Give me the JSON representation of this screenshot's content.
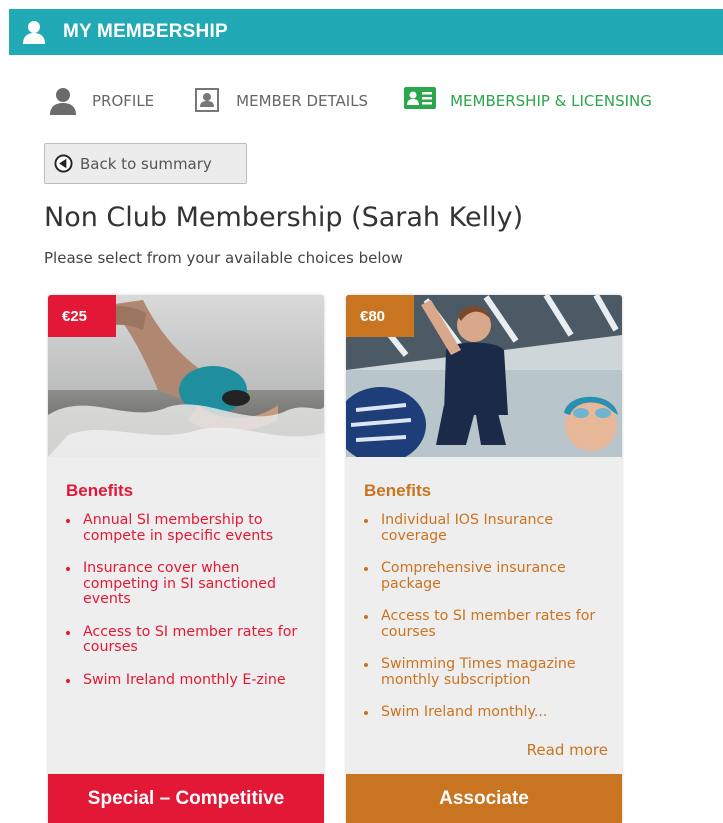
{
  "header": {
    "title": "MY MEMBERSHIP",
    "icon": "user-icon"
  },
  "nav": [
    {
      "label": "PROFILE",
      "icon": "user-icon",
      "active": false
    },
    {
      "label": "MEMBER DETAILS",
      "icon": "id-badge-icon",
      "active": false
    },
    {
      "label": "MEMBERSHIP & LICENSING",
      "icon": "id-card-icon",
      "active": true
    }
  ],
  "back": {
    "label": "Back to summary",
    "icon": "back-arrow-icon"
  },
  "page": {
    "title": "Non Club Membership (Sarah Kelly)",
    "subtitle": "Please select from your available choices below"
  },
  "cards": [
    {
      "price": "€25",
      "benefits_heading": "Benefits",
      "benefits": [
        "Annual SI membership to compete in specific events",
        "Insurance cover when competing in SI sanctioned events",
        "Access to SI member rates for courses",
        "Swim Ireland monthly E-zine"
      ],
      "button": "Special – Competitive",
      "color": "#e31837"
    },
    {
      "price": "€80",
      "benefits_heading": "Benefits",
      "benefits": [
        "Individual IOS Insurance coverage",
        "Comprehensive insurance package",
        "Access to SI member rates for courses",
        "Swimming Times magazine monthly subscription",
        "Swim Ireland monthly..."
      ],
      "read_more": "Read more",
      "button": "Associate",
      "color": "#c97420"
    }
  ],
  "colors": {
    "header": "#21aab5",
    "active_nav": "#2aa64b"
  }
}
